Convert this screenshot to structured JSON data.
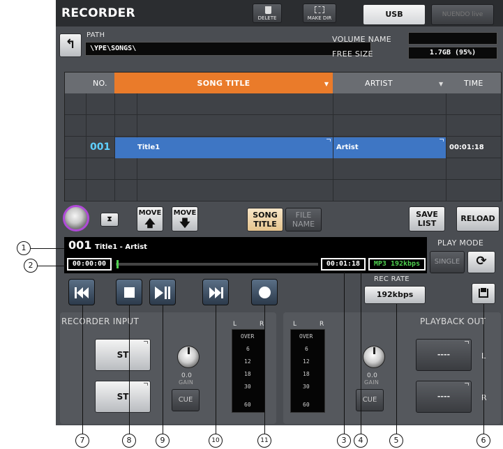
{
  "header": {
    "title": "RECORDER",
    "delete_label": "DELETE",
    "makedir_label": "MAKE DIR",
    "usb_tab": "USB",
    "nuendo_tab": "NUENDO live"
  },
  "path": {
    "label": "PATH",
    "value": "\\YPE\\SONGS\\"
  },
  "volume": {
    "name_label": "VOLUME NAME",
    "name_value": "",
    "free_label": "FREE SIZE",
    "free_value": "1.7GB (95%)"
  },
  "table": {
    "headers": {
      "no": "NO.",
      "song_title": "SONG TITLE",
      "artist": "ARTIST",
      "time": "TIME"
    },
    "selected_row": {
      "no": "001",
      "title": "Title1",
      "artist": "Artist",
      "time": "00:01:18"
    }
  },
  "controls": {
    "move_label": "MOVE",
    "song_label": "SONG",
    "title_label": "TITLE",
    "file_label": "FILE",
    "name_label": "NAME",
    "save_label": "SAVE",
    "list_label": "LIST",
    "reload_label": "RELOAD"
  },
  "now_playing": {
    "number": "001",
    "title": "Title1",
    "separator": " - ",
    "artist": "Artist",
    "elapsed": "00:00:00",
    "total": "00:01:18",
    "format": "MP3 192kbps",
    "progress": 0.0
  },
  "play_mode": {
    "label": "PLAY MODE",
    "single_label": "SINGLE"
  },
  "rec_rate": {
    "label": "REC RATE",
    "value": "192kbps"
  },
  "recorder_input": {
    "label": "RECORDER INPUT",
    "st_label": "ST",
    "gain_value": "0.0",
    "gain_label": "GAIN",
    "cue_label": "CUE"
  },
  "playback_out": {
    "label": "PLAYBACK OUT",
    "slot_value": "----",
    "l_label": "L",
    "r_label": "R",
    "gain_value": "0.0",
    "gain_label": "GAIN",
    "cue_label": "CUE"
  },
  "meter": {
    "l_label": "L",
    "r_label": "R",
    "scale": [
      "OVER",
      "6",
      "12",
      "18",
      "30",
      "60"
    ]
  },
  "callouts": [
    "1",
    "2",
    "3",
    "4",
    "5",
    "6",
    "7",
    "8",
    "9",
    "10",
    "11"
  ]
}
